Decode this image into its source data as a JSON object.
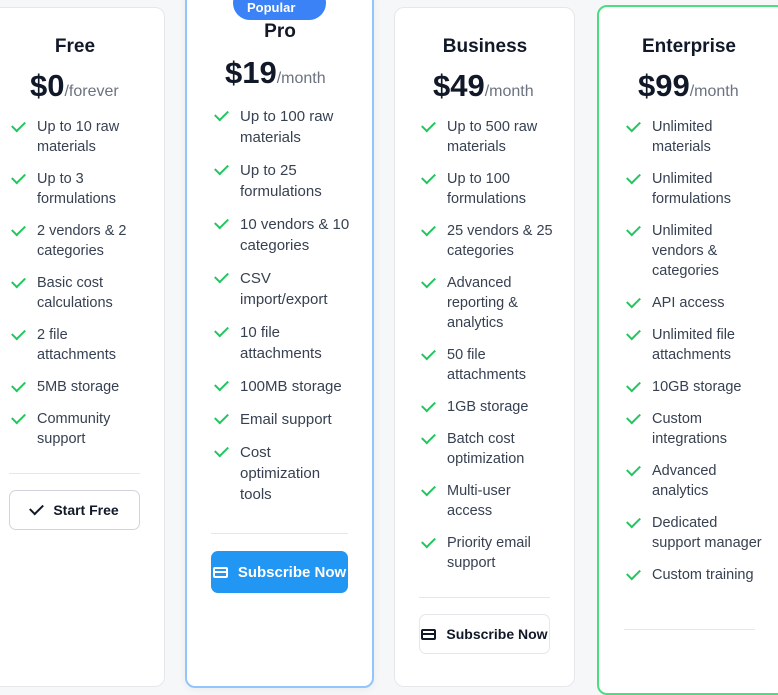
{
  "plans": {
    "free": {
      "name": "Free",
      "price": "$0",
      "period": "/forever",
      "features": [
        "Up to 10 raw materials",
        "Up to 3 formulations",
        "2 vendors & 2 categories",
        "Basic cost calculations",
        "2 file attachments",
        "5MB storage",
        "Community support"
      ],
      "button": "Start Free"
    },
    "pro": {
      "badge": "Popular",
      "name": "Pro",
      "price": "$19",
      "period": "/month",
      "features": [
        "Up to 100 raw materials",
        "Up to 25 formulations",
        "10 vendors & 10 categories",
        "CSV import/export",
        "10 file attachments",
        "100MB storage",
        "Email support",
        "Cost optimization tools"
      ],
      "button": "Subscribe Now"
    },
    "business": {
      "name": "Business",
      "price": "$49",
      "period": "/month",
      "features": [
        "Up to 500 raw materials",
        "Up to 100 formulations",
        "25 vendors & 25 categories",
        "Advanced reporting & analytics",
        "50 file attachments",
        "1GB storage",
        "Batch cost optimization",
        "Multi-user access",
        "Priority email support"
      ],
      "button": "Subscribe Now"
    },
    "enterprise": {
      "name": "Enterprise",
      "price": "$99",
      "period": "/month",
      "features": [
        "Unlimited materials",
        "Unlimited formulations",
        "Unlimited vendors & categories",
        "API access",
        "Unlimited file attachments",
        "10GB storage",
        "Custom integrations",
        "Advanced analytics",
        "Dedicated support manager",
        "Custom training"
      ]
    }
  },
  "icons": {
    "feature": "check-icon",
    "free_button": "check-icon",
    "subscribe_button": "credit-card-icon"
  },
  "colors": {
    "check": "#22c55e",
    "primary": "#2196f3",
    "pro_border": "#93c5fd",
    "enterprise_border": "#4ade80"
  }
}
